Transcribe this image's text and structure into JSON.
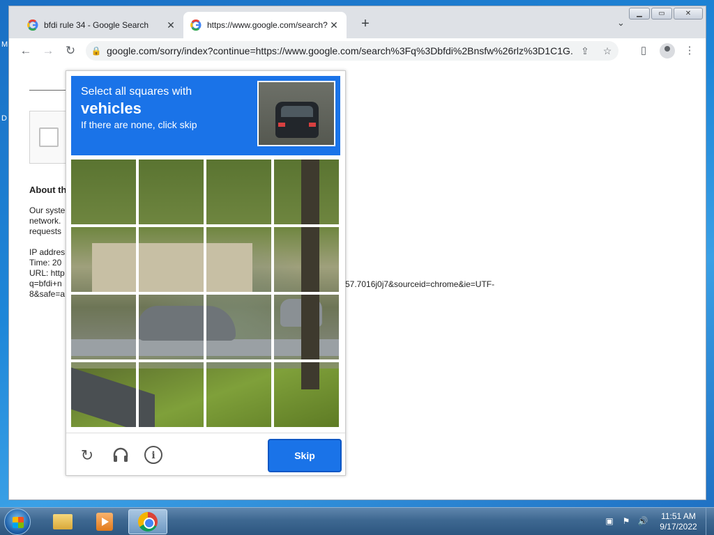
{
  "desktop": {
    "edge_text_1": "M",
    "edge_text_2": "D"
  },
  "browser": {
    "tabs": [
      {
        "title": "bfdi rule 34 - Google Search",
        "close": "✕"
      },
      {
        "title": "https://www.google.com/search?",
        "close": "✕"
      }
    ],
    "new_tab": "+",
    "tab_list": "⌄",
    "window_buttons": {
      "minimize": "▁",
      "maximize": "▭",
      "close": "✕"
    },
    "nav": {
      "back": "←",
      "forward": "→",
      "reload": "↻"
    },
    "address": "google.com/sorry/index?continue=https://www.google.com/search%3Fq%3Dbfdi%2Bnsfw%26rlz%3D1C1G...",
    "toolbar_icons": {
      "share": "⇪",
      "bookmark": "☆",
      "side_panel": "▯",
      "menu": "⋮"
    }
  },
  "page": {
    "heading": "About th",
    "text_lines_1": [
      "Our syste",
      "network.",
      "requests"
    ],
    "text_lines_2": [
      "IP addres",
      "Time: 20",
      "URL: http",
      "q=bfdi+n",
      "8&safe=a"
    ],
    "url_tail": "57.7016j0j7&sourceid=chrome&ie=UTF-"
  },
  "captcha": {
    "instruction": "Select all squares with",
    "target": "vehicles",
    "hint": "If there are none, click skip",
    "skip_label": "Skip",
    "icons": {
      "reload": "↻",
      "audio": "🎧",
      "info": "i"
    }
  },
  "taskbar": {
    "clock_time": "11:51 AM",
    "clock_date": "9/17/2022",
    "tray_icons": [
      "▣",
      "⚑",
      "🔊"
    ]
  }
}
